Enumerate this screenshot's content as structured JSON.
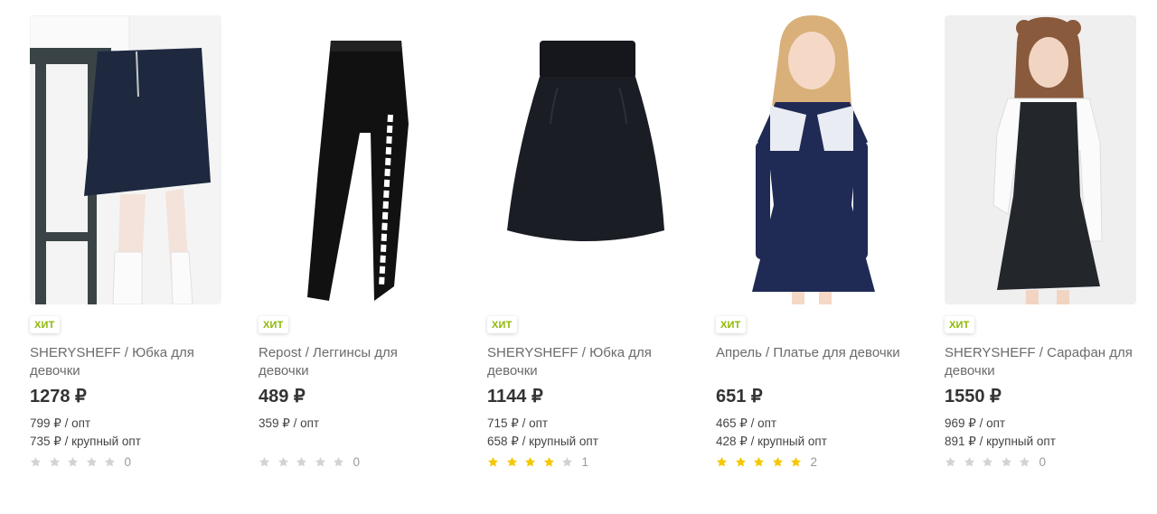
{
  "colors": {
    "badge_text": "#8cb800",
    "star_filled": "#f5c800",
    "star_empty": "#d3d3d3"
  },
  "products": [
    {
      "badge": "ХИТ",
      "title": "SHERYSHEFF / Юбка для девочки",
      "price": "1278 ₽",
      "opt": "799 ₽ / опт",
      "bulk": "735 ₽ / крупный опт",
      "rating": 0,
      "reviews": "0",
      "image_icon": "skirt-photo"
    },
    {
      "badge": "ХИТ",
      "title": "Repost / Леггинсы для девочки",
      "price": "489 ₽",
      "opt": "359 ₽ / опт",
      "bulk": "",
      "rating": 0,
      "reviews": "0",
      "image_icon": "leggings-photo"
    },
    {
      "badge": "ХИТ",
      "title": "SHERYSHEFF / Юбка для девочки",
      "price": "1144 ₽",
      "opt": "715 ₽ / опт",
      "bulk": "658 ₽ / крупный опт",
      "rating": 4,
      "reviews": "1",
      "image_icon": "skirt-photo"
    },
    {
      "badge": "ХИТ",
      "title": "Апрель / Платье для девочки",
      "price": "651 ₽",
      "opt": "465 ₽ / опт",
      "bulk": "428 ₽ / крупный опт",
      "rating": 5,
      "reviews": "2",
      "image_icon": "dress-photo"
    },
    {
      "badge": "ХИТ",
      "title": "SHERYSHEFF / Сарафан для девочки",
      "price": "1550 ₽",
      "opt": "969 ₽ / опт",
      "bulk": "891 ₽ / крупный опт",
      "rating": 0,
      "reviews": "0",
      "image_icon": "sundress-photo"
    }
  ]
}
